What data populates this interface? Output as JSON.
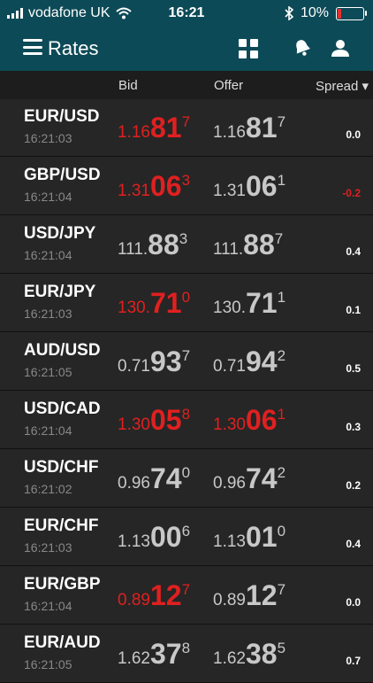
{
  "status": {
    "carrier": "vodafone UK",
    "time": "16:21",
    "battery": "10%"
  },
  "header": {
    "title": "Rates"
  },
  "columns": {
    "bid": "Bid",
    "offer": "Offer",
    "spread": "Spread ▾"
  },
  "rows": [
    {
      "pair": "EUR/USD",
      "time": "16:21:03",
      "bid": {
        "pre": "1.16",
        "big": "81",
        "sup": "7",
        "color": "red"
      },
      "offer": {
        "pre": "1.16",
        "big": "81",
        "sup": "7",
        "color": "grey"
      },
      "spread": "0.0"
    },
    {
      "pair": "GBP/USD",
      "time": "16:21:04",
      "bid": {
        "pre": "1.31",
        "big": "06",
        "sup": "3",
        "color": "red"
      },
      "offer": {
        "pre": "1.31",
        "big": "06",
        "sup": "1",
        "color": "grey"
      },
      "spread": "-0.2"
    },
    {
      "pair": "USD/JPY",
      "time": "16:21:04",
      "bid": {
        "pre": "111.",
        "big": "88",
        "sup": "3",
        "color": "grey"
      },
      "offer": {
        "pre": "111.",
        "big": "88",
        "sup": "7",
        "color": "grey"
      },
      "spread": "0.4"
    },
    {
      "pair": "EUR/JPY",
      "time": "16:21:03",
      "bid": {
        "pre": "130.",
        "big": "71",
        "sup": "0",
        "color": "red"
      },
      "offer": {
        "pre": "130.",
        "big": "71",
        "sup": "1",
        "color": "grey"
      },
      "spread": "0.1"
    },
    {
      "pair": "AUD/USD",
      "time": "16:21:05",
      "bid": {
        "pre": "0.71",
        "big": "93",
        "sup": "7",
        "color": "grey"
      },
      "offer": {
        "pre": "0.71",
        "big": "94",
        "sup": "2",
        "color": "grey"
      },
      "spread": "0.5"
    },
    {
      "pair": "USD/CAD",
      "time": "16:21:04",
      "bid": {
        "pre": "1.30",
        "big": "05",
        "sup": "8",
        "color": "red"
      },
      "offer": {
        "pre": "1.30",
        "big": "06",
        "sup": "1",
        "color": "red"
      },
      "spread": "0.3"
    },
    {
      "pair": "USD/CHF",
      "time": "16:21:02",
      "bid": {
        "pre": "0.96",
        "big": "74",
        "sup": "0",
        "color": "grey"
      },
      "offer": {
        "pre": "0.96",
        "big": "74",
        "sup": "2",
        "color": "grey"
      },
      "spread": "0.2"
    },
    {
      "pair": "EUR/CHF",
      "time": "16:21:03",
      "bid": {
        "pre": "1.13",
        "big": "00",
        "sup": "6",
        "color": "grey"
      },
      "offer": {
        "pre": "1.13",
        "big": "01",
        "sup": "0",
        "color": "grey"
      },
      "spread": "0.4"
    },
    {
      "pair": "EUR/GBP",
      "time": "16:21:04",
      "bid": {
        "pre": "0.89",
        "big": "12",
        "sup": "7",
        "color": "red"
      },
      "offer": {
        "pre": "0.89",
        "big": "12",
        "sup": "7",
        "color": "grey"
      },
      "spread": "0.0"
    },
    {
      "pair": "EUR/AUD",
      "time": "16:21:05",
      "bid": {
        "pre": "1.62",
        "big": "37",
        "sup": "8",
        "color": "grey"
      },
      "offer": {
        "pre": "1.62",
        "big": "38",
        "sup": "5",
        "color": "grey"
      },
      "spread": "0.7"
    }
  ]
}
